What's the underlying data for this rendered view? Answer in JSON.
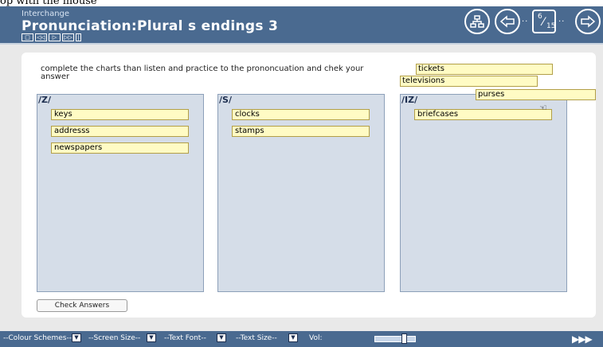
{
  "fragment": "op with the mouse",
  "header": {
    "subtitle": "Interchange",
    "title": "Pronunciation:Plural s endings 3",
    "media_buttons": [
      "□",
      "◁◁",
      "▷",
      "▷▷",
      "|"
    ],
    "page_current": "6",
    "page_total": "15",
    "icons": [
      "sitemap-icon",
      "back-arrow-icon",
      "forward-arrow-icon"
    ]
  },
  "instructions": "complete the charts than listen and practice to the prononcuation and chek your answer",
  "columns": [
    {
      "title": "/Z/",
      "items": [
        "keys",
        "addresss",
        "newspapers"
      ]
    },
    {
      "title": "/S/",
      "items": [
        "clocks",
        "stamps"
      ]
    },
    {
      "title": "/IZ/",
      "items": [
        "briefcases"
      ]
    }
  ],
  "draggable_words": [
    "tickets",
    "televisions",
    "purses"
  ],
  "check_button": "Check Answers",
  "bottom_bar": {
    "colour_schemes": "--Colour Schemes--",
    "screen_size": "--Screen Size--",
    "text_font": "--Text Font--",
    "text_size": "--Text Size--",
    "volume_label": "Vol:",
    "volume_level": 0.7,
    "forward": "▶▶▶"
  },
  "colors": {
    "header": "#4a6a90",
    "column_bg": "#d5dde8",
    "word_bg": "#fffbc4"
  }
}
